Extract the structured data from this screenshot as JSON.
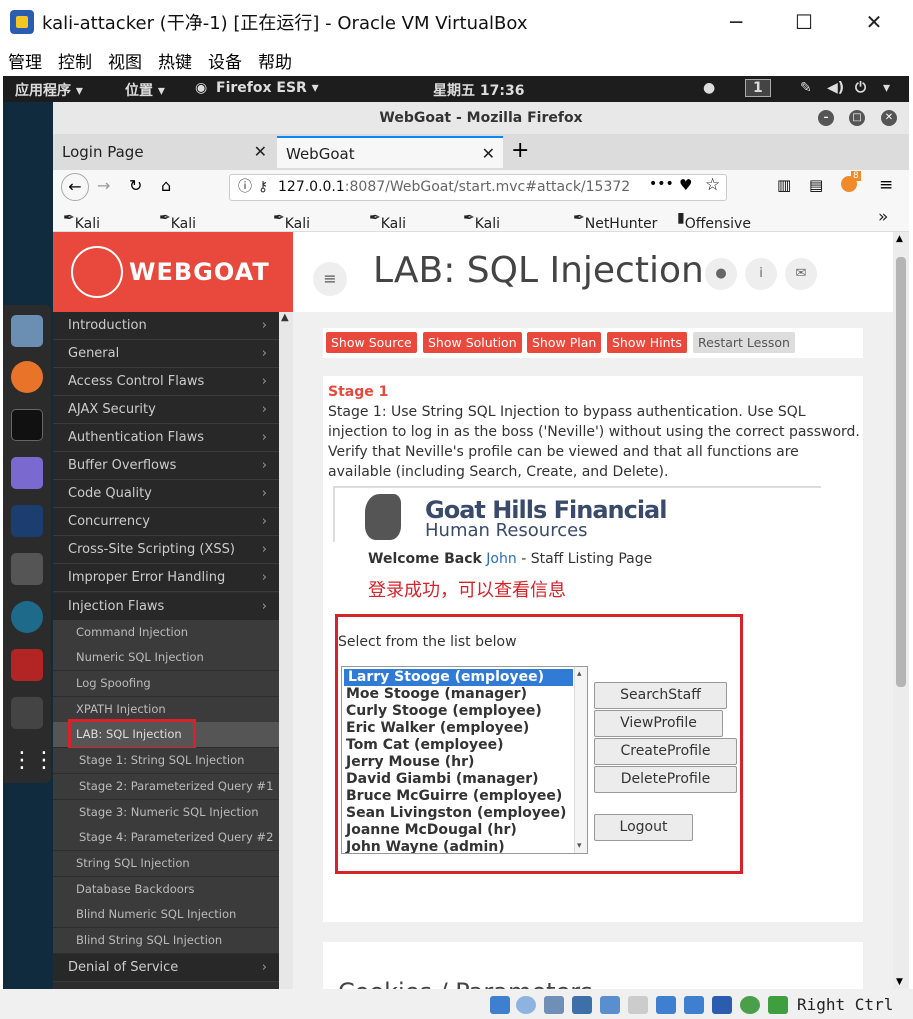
{
  "vbox": {
    "title": "kali-attacker (干净-1) [正在运行] - Oracle VM VirtualBox",
    "min": "─",
    "max": "☐",
    "close": "✕",
    "menu": [
      "管理",
      "控制",
      "视图",
      "热键",
      "设备",
      "帮助"
    ],
    "host_key": "Right Ctrl"
  },
  "gnome": {
    "apps": "应用程序 ▾",
    "places": "位置 ▾",
    "firefox": "Firefox ESR ▾",
    "clock": "星期五 17:36",
    "workspace": "1"
  },
  "firefox": {
    "window_title": "WebGoat - Mozilla Firefox",
    "tabs": [
      {
        "label": "Login Page"
      },
      {
        "label": "WebGoat"
      }
    ],
    "new_tab": "+",
    "url_host": "127.0.0.1",
    "url_rest": ":8087/WebGoat/start.mvc#attack/15372",
    "url_more": "•••",
    "badge": "8",
    "bookmarks": [
      "Kali Linux",
      "Kali Training",
      "Kali Tools",
      "Kali Docs",
      "Kali Forums",
      "NetHunter",
      "Offensive Security"
    ],
    "bookmarks_more": "»"
  },
  "webgoat": {
    "logo": "WEBGOAT",
    "lab_title": "LAB: SQL Injection",
    "sidebar_top": [
      "Introduction",
      "General",
      "Access Control Flaws",
      "AJAX Security",
      "Authentication Flaws",
      "Buffer Overflows",
      "Code Quality",
      "Concurrency",
      "Cross-Site Scripting (XSS)",
      "Improper Error Handling",
      "Injection Flaws"
    ],
    "sidebar_sub": [
      "Command Injection",
      "Numeric SQL Injection",
      "Log Spoofing",
      "XPATH Injection",
      "LAB: SQL Injection"
    ],
    "sidebar_stages": [
      "Stage 1: String SQL Injection",
      "Stage 2: Parameterized Query #1",
      "Stage 3: Numeric SQL Injection",
      "Stage 4: Parameterized Query #2"
    ],
    "sidebar_sub2": [
      "String SQL Injection",
      "Database Backdoors",
      "Blind Numeric SQL Injection",
      "Blind String SQL Injection"
    ],
    "sidebar_bottom": "Denial of Service",
    "buttons": {
      "show_source": "Show Source",
      "show_solution": "Show Solution",
      "show_plan": "Show Plan",
      "show_hints": "Show Hints",
      "restart": "Restart Lesson"
    },
    "stage_heading": "Stage 1",
    "stage_desc": "Stage 1: Use String SQL Injection to bypass authentication. Use SQL injection to log in as the boss ('Neville') without using the correct password. Verify that Neville's profile can be viewed and that all functions are available (including Search, Create, and Delete).",
    "ghf_title": "Goat Hills Financial",
    "ghf_sub": "Human Resources",
    "welcome_prefix": "Welcome Back",
    "welcome_user": "John",
    "welcome_suffix": "- Staff Listing Page",
    "annotation": "登录成功，可以查看信息",
    "select_label": "Select from the list below",
    "staff": [
      "Larry Stooge (employee)",
      "Moe Stooge (manager)",
      "Curly Stooge (employee)",
      "Eric Walker (employee)",
      "Tom Cat (employee)",
      "Jerry Mouse (hr)",
      "David Giambi (manager)",
      "Bruce McGuirre (employee)",
      "Sean Livingston (employee)",
      "Joanne McDougal (hr)",
      "John Wayne (admin)"
    ],
    "actions": {
      "search": "SearchStaff",
      "view": "ViewProfile",
      "create": "CreateProfile",
      "delete": "DeleteProfile",
      "logout": "Logout"
    },
    "cookies_title": "Cookies / Parameters"
  },
  "colors": {
    "webgoat_red": "#e8493c",
    "annotation_red": "#d8222a",
    "sidebar_bg": "#2d2d2d"
  }
}
